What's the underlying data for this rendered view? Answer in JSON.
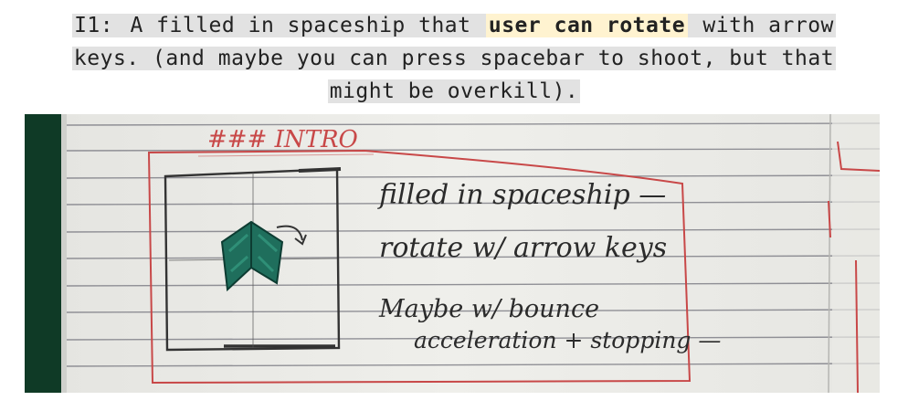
{
  "caption": {
    "label": "I1:",
    "text_before": " A filled in spaceship that ",
    "highlight": "user can rotate",
    "text_after_line1": " with arrow",
    "line2": "keys. (and maybe you can press spacebar to shoot, but that",
    "line3": "might be overkill)."
  },
  "sketch": {
    "heading": "### INTRO",
    "notes": [
      "filled in spaceship —",
      "rotate w/ arrow keys",
      "Maybe w/ bounce",
      "acceleration + stopping —"
    ]
  },
  "colors": {
    "highlight_bg": "#fff3d0",
    "caption_bg": "#e2e2e2",
    "paper": "#ecece8",
    "ruled_line": "#8f8f95",
    "red_ink": "#c84848",
    "pencil": "#333333",
    "marker_green": "#1f6e5c"
  }
}
